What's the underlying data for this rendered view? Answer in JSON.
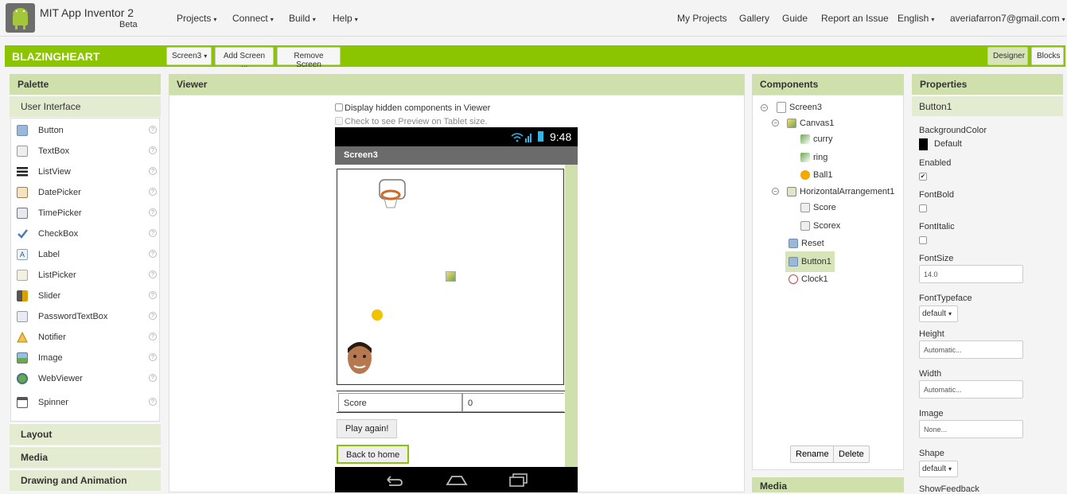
{
  "header": {
    "app_title": "MIT App Inventor 2",
    "app_subtitle": "Beta",
    "menu": [
      "Projects",
      "Connect",
      "Build",
      "Help"
    ],
    "right_links": [
      "My Projects",
      "Gallery",
      "Guide",
      "Report an Issue"
    ],
    "language": "English",
    "user": "averiafarron7@gmail.com"
  },
  "toolbar": {
    "project_name": "BLAZINGHEART",
    "screen_select": "Screen3",
    "add_screen": "Add Screen ...",
    "remove_screen": "Remove Screen",
    "designer": "Designer",
    "blocks": "Blocks"
  },
  "palette": {
    "title": "Palette",
    "category": "User Interface",
    "help_glyph": "?",
    "items": [
      "Button",
      "TextBox",
      "ListView",
      "DatePicker",
      "TimePicker",
      "CheckBox",
      "Label",
      "ListPicker",
      "Slider",
      "PasswordTextBox",
      "Notifier",
      "Image",
      "WebViewer",
      "Spinner"
    ],
    "other_categories": [
      "Layout",
      "Media",
      "Drawing and Animation"
    ]
  },
  "viewer": {
    "title": "Viewer",
    "option_hidden": "Display hidden components in Viewer",
    "option_tablet": "Check to see Preview on Tablet size.",
    "phone_time": "9:48",
    "screen_title": "Screen3",
    "score_label": "Score",
    "score_value": "0",
    "play_again": "Play again!",
    "back_home": "Back to home"
  },
  "components": {
    "title": "Components",
    "tree": {
      "screen": "Screen3",
      "canvas": "Canvas1",
      "canvas_children": [
        "curry",
        "ring",
        "Ball1"
      ],
      "arrangement": "HorizontalArrangement1",
      "arrangement_children": [
        "Score",
        "Scorex"
      ],
      "others": [
        "Reset",
        "Button1",
        "Clock1"
      ]
    },
    "rename": "Rename",
    "delete": "Delete",
    "media_title": "Media"
  },
  "properties": {
    "title": "Properties",
    "component": "Button1",
    "background_color_label": "BackgroundColor",
    "background_color_value": "Default",
    "enabled_label": "Enabled",
    "font_bold_label": "FontBold",
    "font_italic_label": "FontItalic",
    "font_size_label": "FontSize",
    "font_size_value": "14.0",
    "font_typeface_label": "FontTypeface",
    "font_typeface_value": "default",
    "height_label": "Height",
    "height_value": "Automatic...",
    "width_label": "Width",
    "width_value": "Automatic...",
    "image_label": "Image",
    "image_value": "None...",
    "shape_label": "Shape",
    "shape_value": "default",
    "show_feedback_label": "ShowFeedback"
  },
  "colors": {
    "green": "#8bc400",
    "panel_head": "#cfe0ad",
    "selected": "#d7e3b9"
  }
}
